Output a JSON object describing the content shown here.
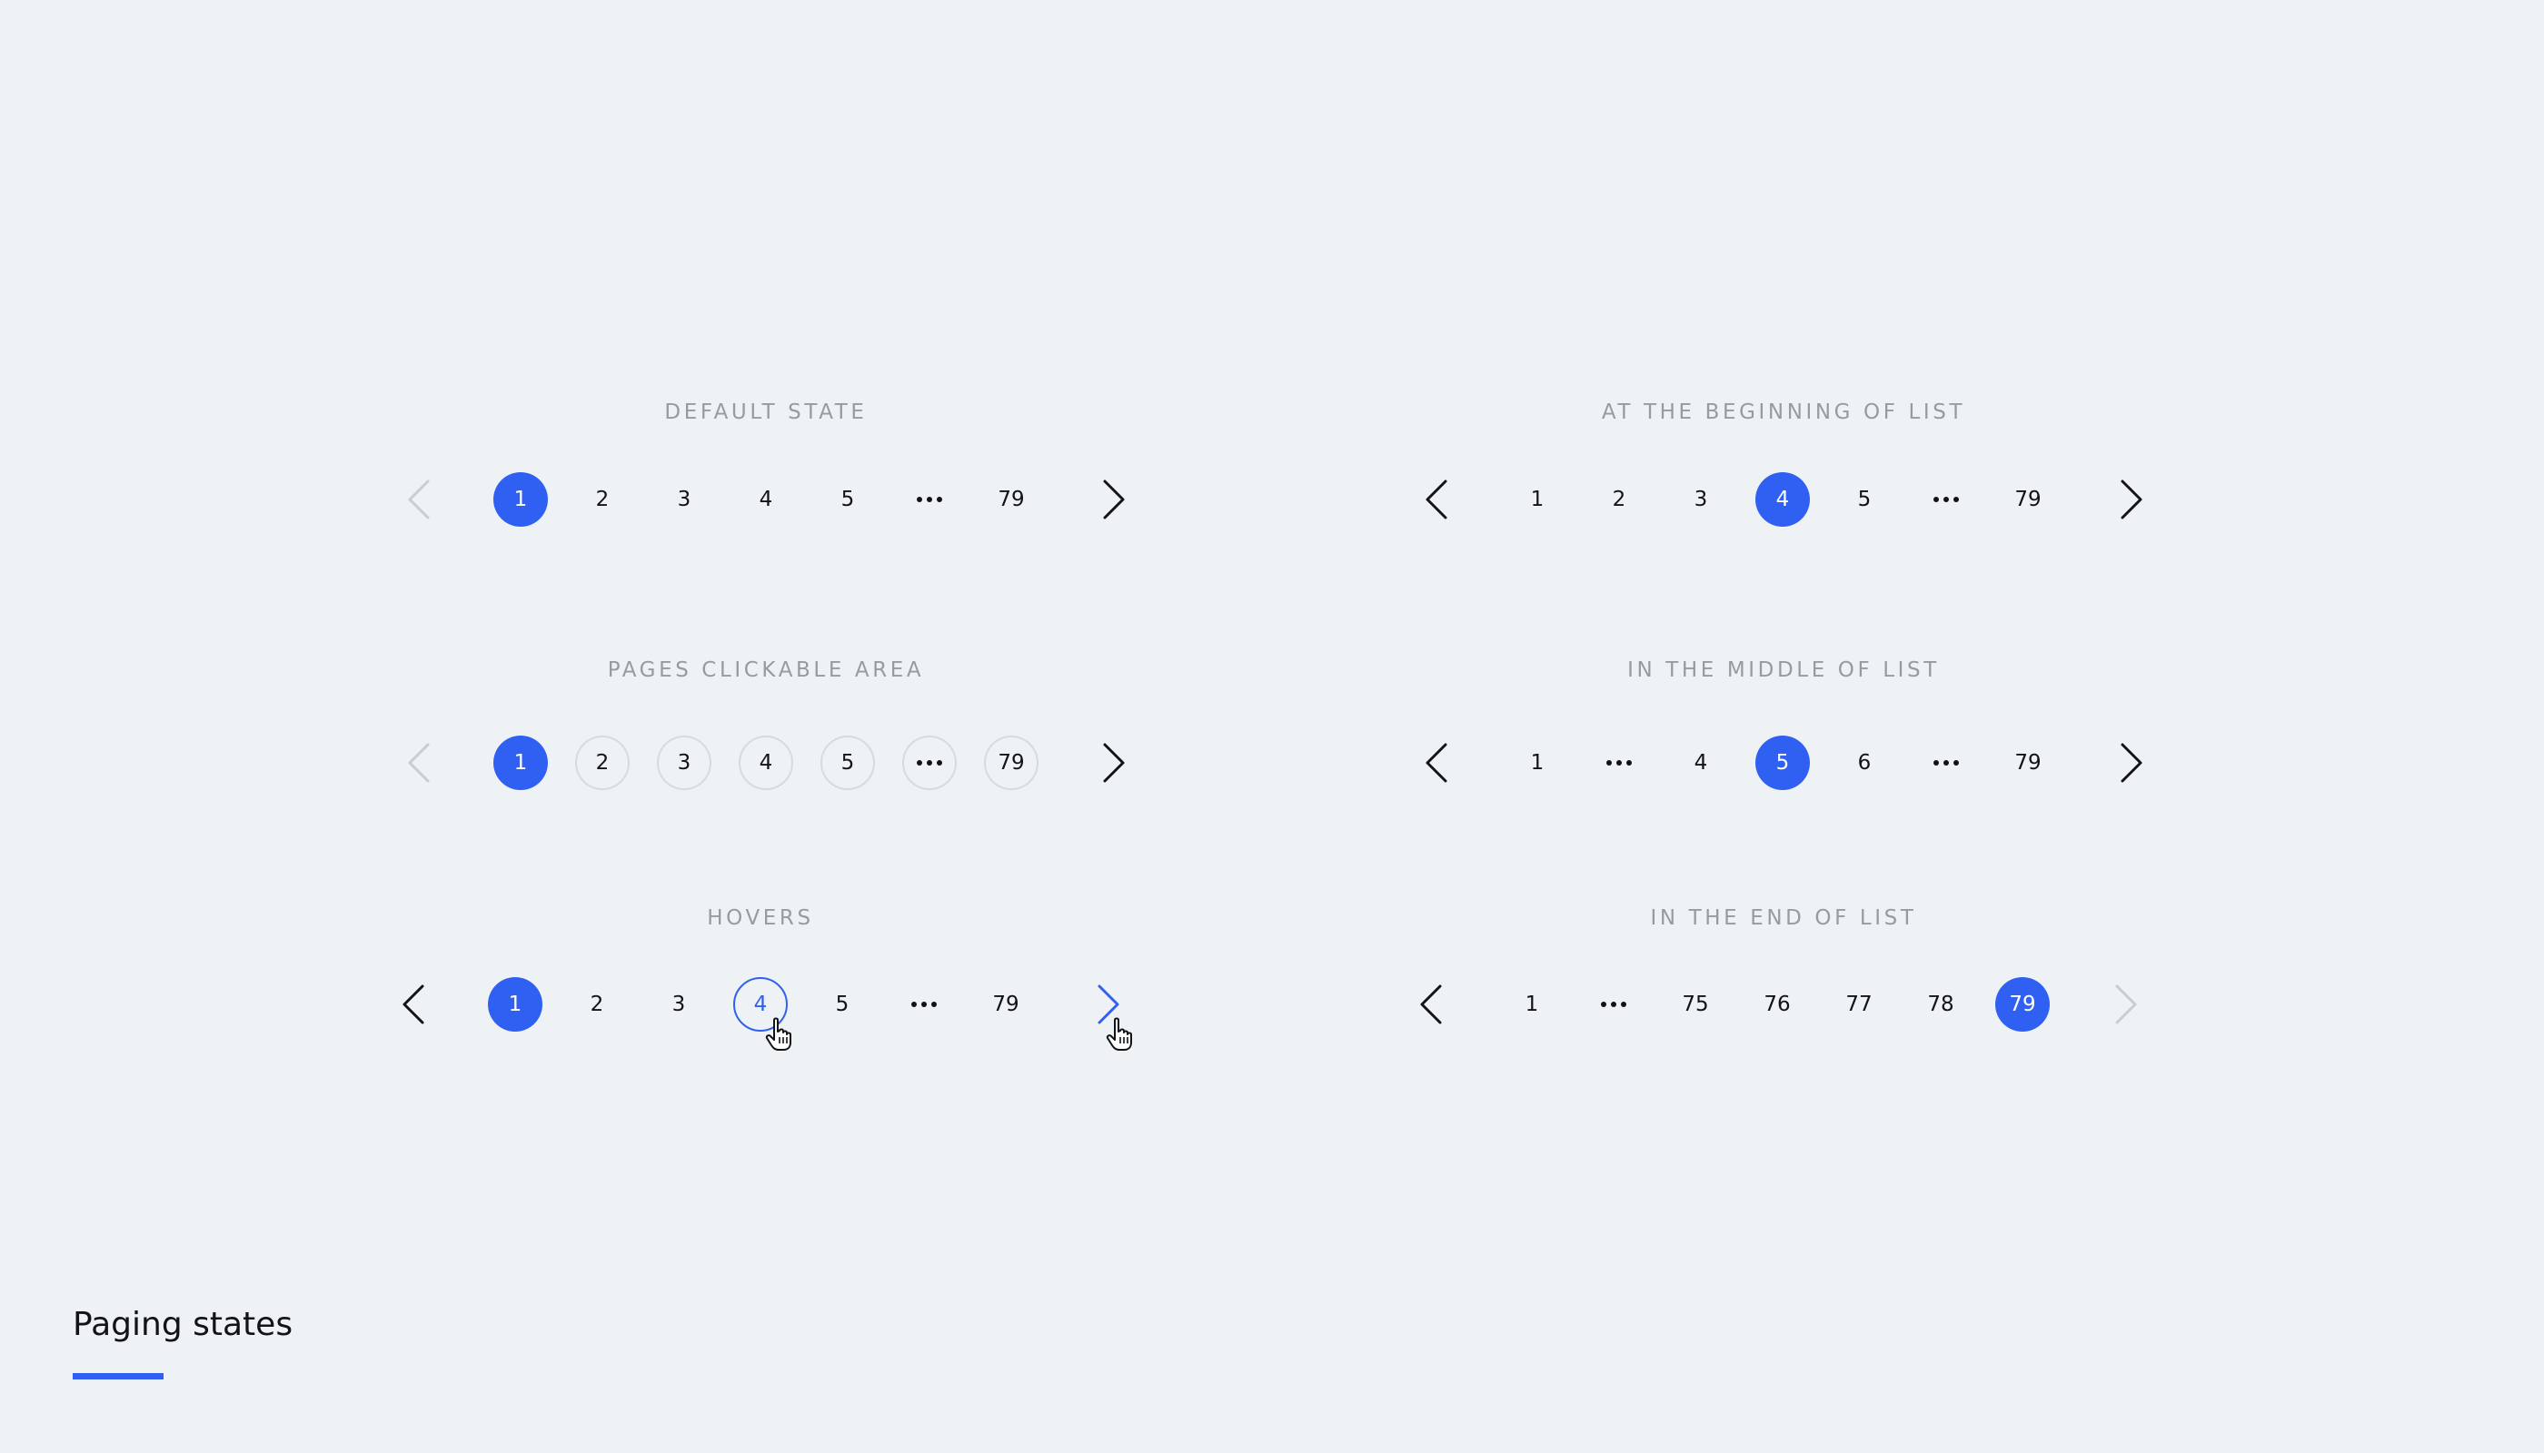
{
  "title": "Paging states",
  "accent_color": "#3060f2",
  "sections": [
    {
      "label": "DEFAULT STATE",
      "prev_state": "disabled",
      "next_state": "enabled",
      "pages": [
        {
          "label": "1",
          "state": "active"
        },
        {
          "label": "2",
          "state": "normal"
        },
        {
          "label": "3",
          "state": "normal"
        },
        {
          "label": "4",
          "state": "normal"
        },
        {
          "label": "5",
          "state": "normal"
        },
        {
          "label": "...",
          "state": "ellipsis"
        },
        {
          "label": "79",
          "state": "normal"
        }
      ]
    },
    {
      "label": "AT THE BEGINNING OF LIST",
      "prev_state": "enabled",
      "next_state": "enabled",
      "pages": [
        {
          "label": "1",
          "state": "normal"
        },
        {
          "label": "2",
          "state": "normal"
        },
        {
          "label": "3",
          "state": "normal"
        },
        {
          "label": "4",
          "state": "active"
        },
        {
          "label": "5",
          "state": "normal"
        },
        {
          "label": "...",
          "state": "ellipsis"
        },
        {
          "label": "79",
          "state": "normal"
        }
      ]
    },
    {
      "label": "PAGES CLICKABLE AREA",
      "prev_state": "disabled",
      "next_state": "enabled",
      "outlined": true,
      "pages": [
        {
          "label": "1",
          "state": "active"
        },
        {
          "label": "2",
          "state": "normal"
        },
        {
          "label": "3",
          "state": "normal"
        },
        {
          "label": "4",
          "state": "normal"
        },
        {
          "label": "5",
          "state": "normal"
        },
        {
          "label": "...",
          "state": "ellipsis"
        },
        {
          "label": "79",
          "state": "normal"
        }
      ]
    },
    {
      "label": "IN THE MIDDLE OF LIST",
      "prev_state": "enabled",
      "next_state": "enabled",
      "pages": [
        {
          "label": "1",
          "state": "normal"
        },
        {
          "label": "...",
          "state": "ellipsis"
        },
        {
          "label": "4",
          "state": "normal"
        },
        {
          "label": "5",
          "state": "active"
        },
        {
          "label": "6",
          "state": "normal"
        },
        {
          "label": "...",
          "state": "ellipsis"
        },
        {
          "label": "79",
          "state": "normal"
        }
      ]
    },
    {
      "label": "HOVERS",
      "prev_state": "enabled",
      "next_state": "hover",
      "pages": [
        {
          "label": "1",
          "state": "active"
        },
        {
          "label": "2",
          "state": "normal"
        },
        {
          "label": "3",
          "state": "normal"
        },
        {
          "label": "4",
          "state": "hover"
        },
        {
          "label": "5",
          "state": "normal"
        },
        {
          "label": "...",
          "state": "ellipsis"
        },
        {
          "label": "79",
          "state": "normal"
        }
      ]
    },
    {
      "label": "IN THE END OF LIST",
      "prev_state": "enabled",
      "next_state": "disabled",
      "pages": [
        {
          "label": "1",
          "state": "normal"
        },
        {
          "label": "...",
          "state": "ellipsis"
        },
        {
          "label": "75",
          "state": "normal"
        },
        {
          "label": "76",
          "state": "normal"
        },
        {
          "label": "77",
          "state": "normal"
        },
        {
          "label": "78",
          "state": "normal"
        },
        {
          "label": "79",
          "state": "active"
        }
      ]
    }
  ]
}
